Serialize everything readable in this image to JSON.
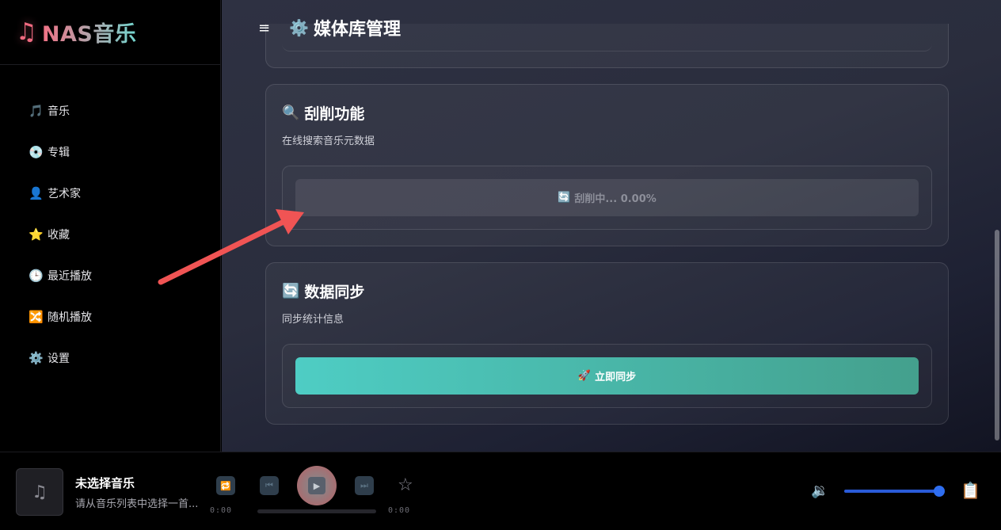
{
  "app": {
    "logo_icon": "♫",
    "logo_text": "NAS音乐"
  },
  "sidebar": {
    "items": [
      {
        "icon": "🎵",
        "icon_name": "music-note-icon",
        "label": "音乐"
      },
      {
        "icon": "💿",
        "icon_name": "disc-icon",
        "label": "专辑"
      },
      {
        "icon": "👤",
        "icon_name": "person-icon",
        "label": "艺术家"
      },
      {
        "icon": "⭐",
        "icon_name": "star-icon",
        "label": "收藏"
      },
      {
        "icon": "🕒",
        "icon_name": "clock-icon",
        "label": "最近播放"
      },
      {
        "icon": "🔀",
        "icon_name": "shuffle-icon",
        "label": "随机播放"
      },
      {
        "icon": "⚙️",
        "icon_name": "gear-icon",
        "label": "设置"
      }
    ]
  },
  "header": {
    "menu_icon": "≡",
    "title_icon": "⚙️",
    "title": "媒体库管理"
  },
  "scrape": {
    "icon": "🔍",
    "title": "刮削功能",
    "desc": "在线搜索音乐元数据",
    "button_icon": "🔄",
    "button_label": "刮削中... 0.00%",
    "progress_percent": 0
  },
  "sync": {
    "icon": "🔄",
    "title": "数据同步",
    "desc": "同步统计信息",
    "button_icon": "🚀",
    "button_label": "立即同步"
  },
  "player": {
    "cover_icon": "♫",
    "song_title": "未选择音乐",
    "song_sub": "请从音乐列表中选择一首...",
    "repeat_icon": "🔁",
    "prev_icon": "⏮",
    "play_icon": "▶",
    "next_icon": "⏭",
    "fav_icon": "☆",
    "time_current": "0:00",
    "time_total": "0:00",
    "volume_icon": "🔉",
    "volume_level": 1.0,
    "queue_icon": "📋"
  },
  "colors": {
    "accent_teal": "#4ecdc4",
    "accent_green": "#44a08d",
    "logo_pink": "#f17185",
    "volume_blue": "#2f6ef0",
    "annotation_arrow": "#f05454"
  }
}
